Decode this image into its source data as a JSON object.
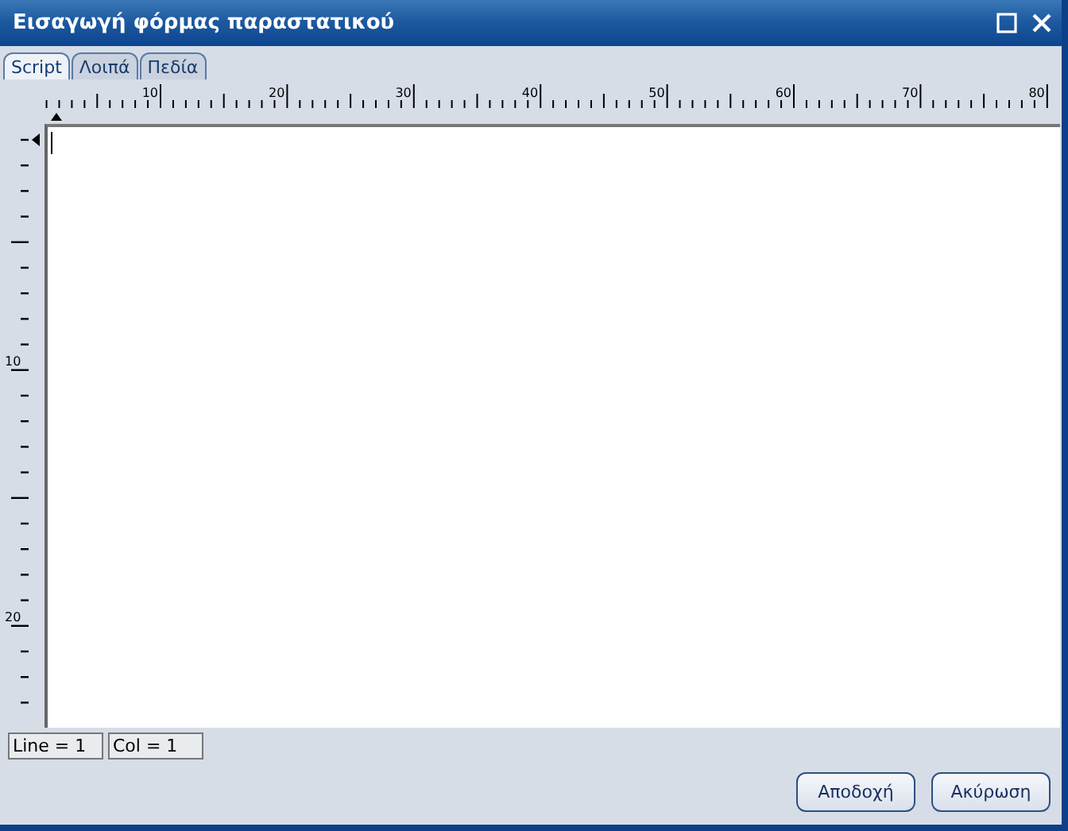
{
  "window": {
    "title": "Εισαγωγή φόρμας παραστατικού"
  },
  "tabs": [
    {
      "label": "Script",
      "selected": true
    },
    {
      "label": "Λοιπά",
      "selected": false
    },
    {
      "label": "Πεδία",
      "selected": false
    }
  ],
  "ruler": {
    "column_numbers": [
      "10",
      "20",
      "30",
      "40",
      "50",
      "60",
      "70",
      "80"
    ],
    "line_numbers": [
      "10",
      "20"
    ]
  },
  "status": {
    "line": "Line = 1",
    "col": "Col = 1"
  },
  "buttons": [
    "Αποδοχή",
    "Ακύρωση"
  ]
}
